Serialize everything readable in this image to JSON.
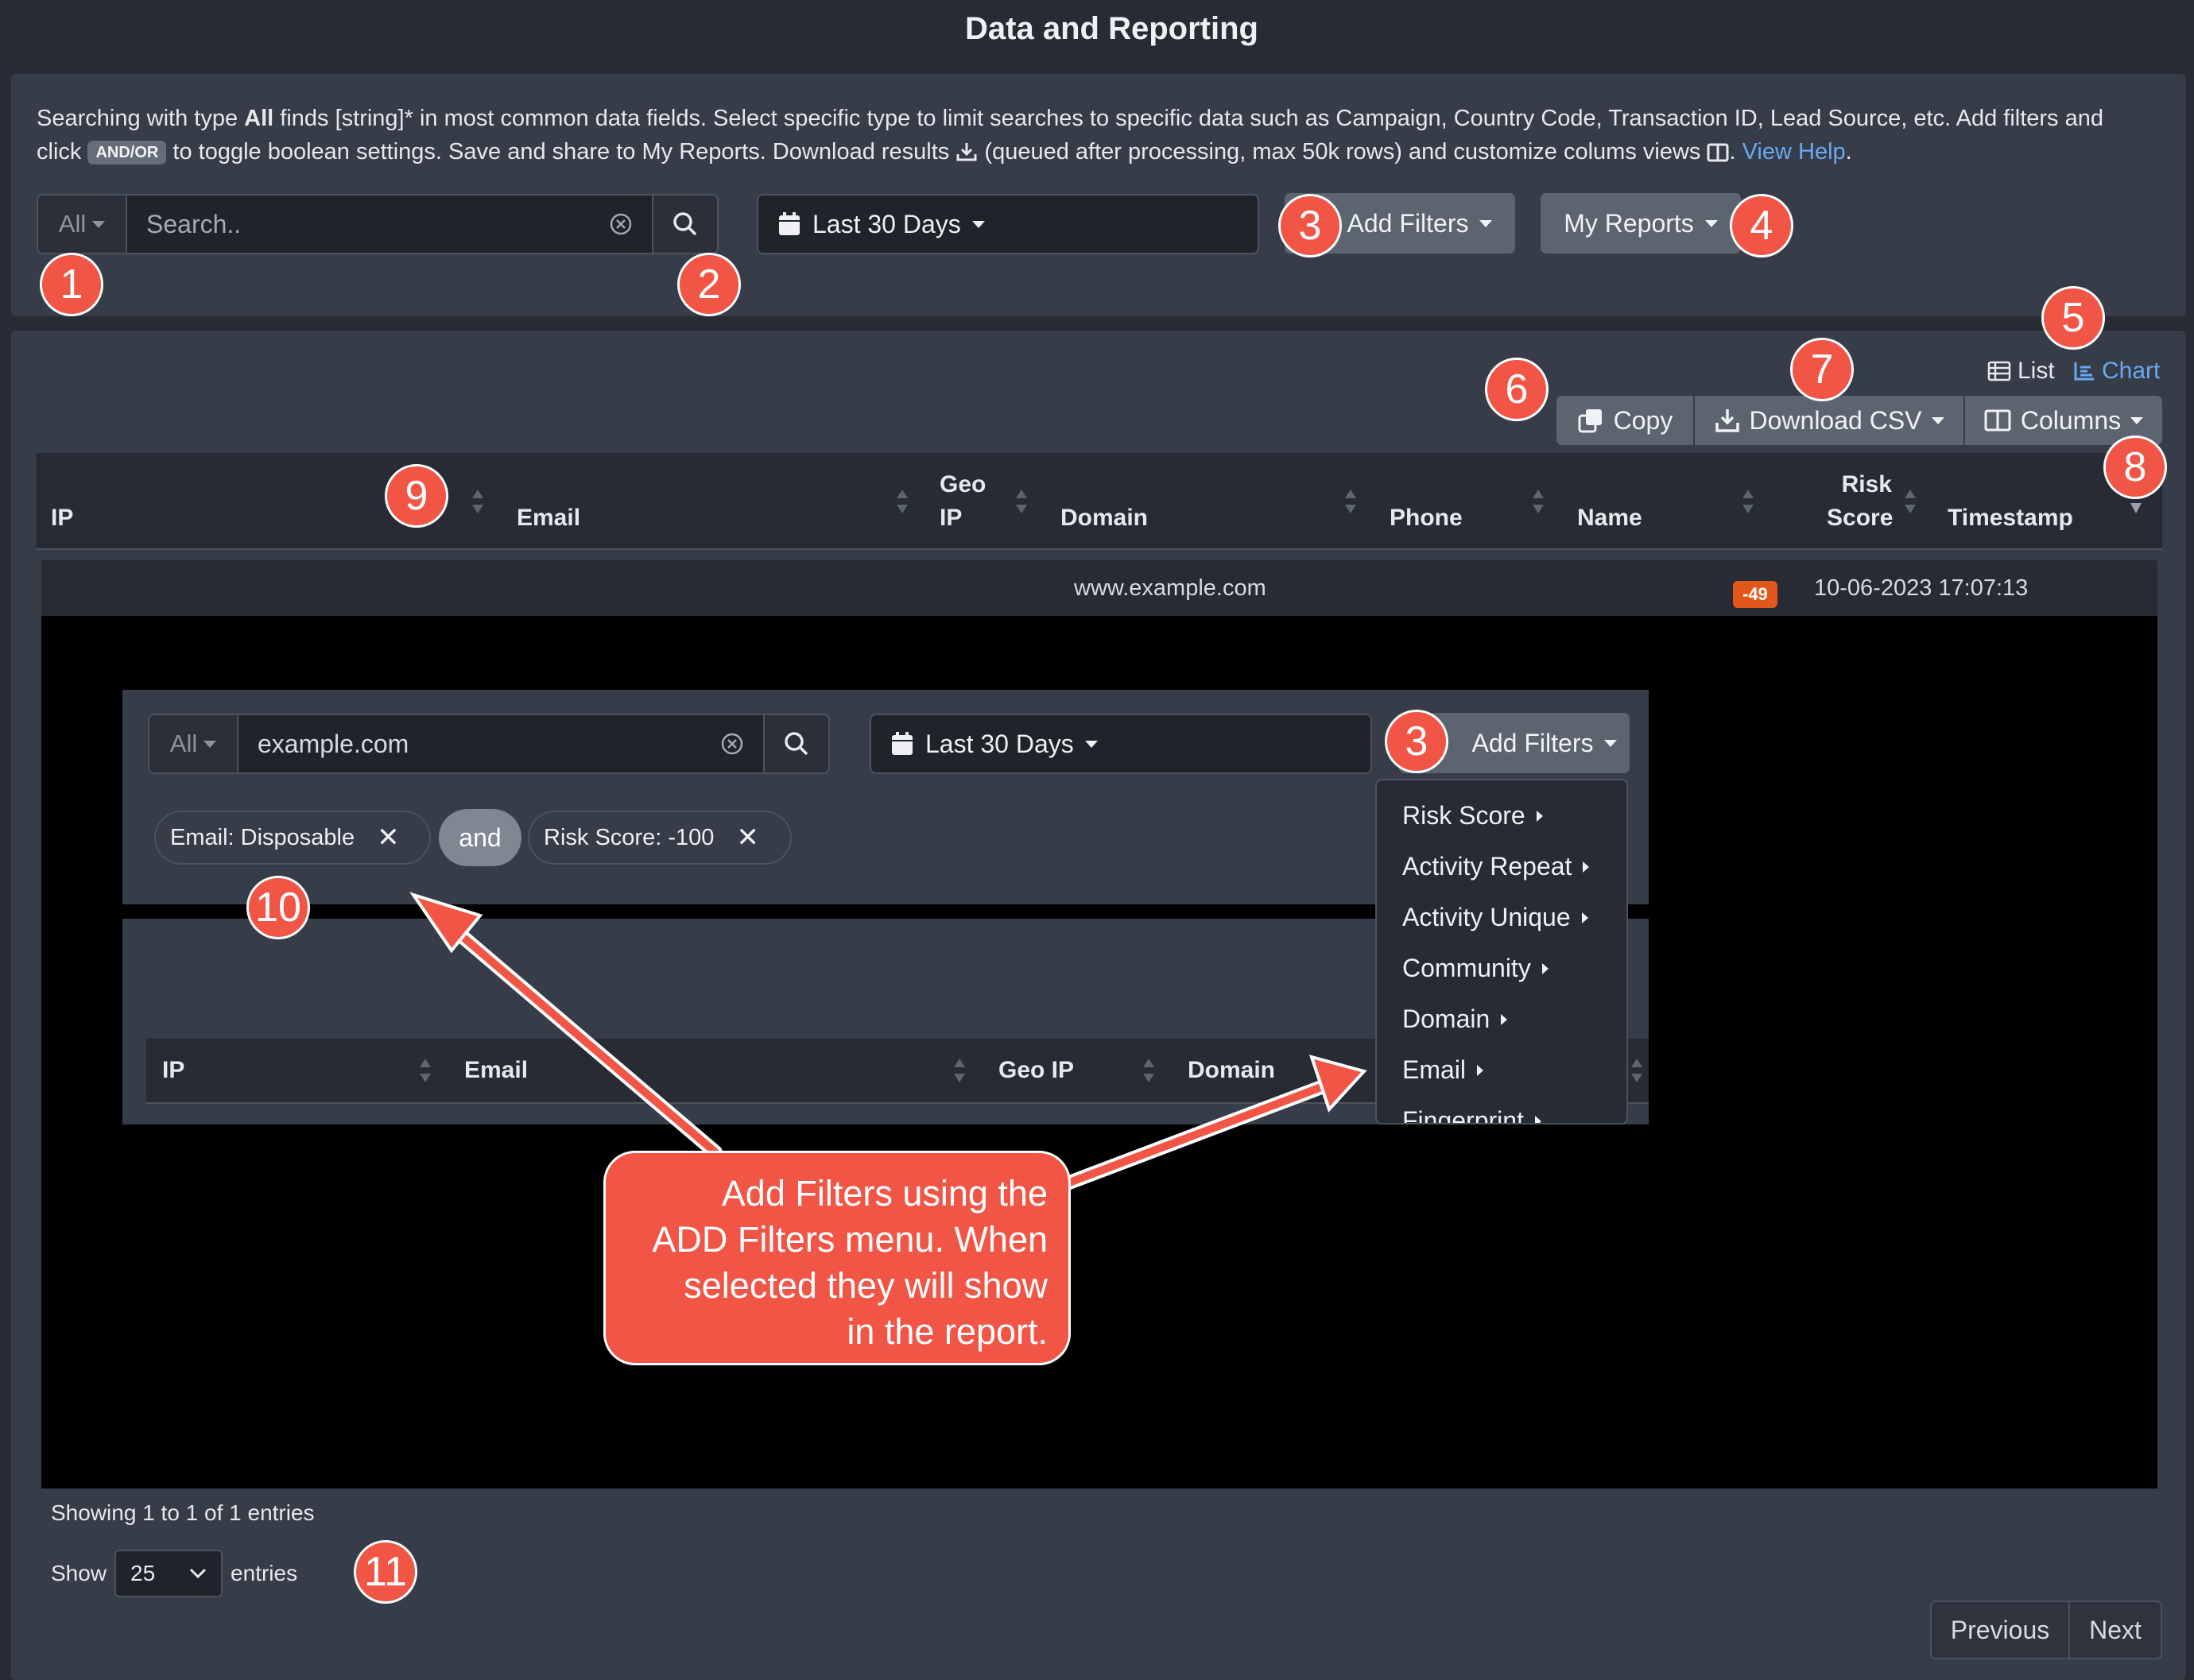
{
  "page": {
    "title": "Data and Reporting"
  },
  "help": {
    "t1": "Searching with type ",
    "t1_bold": "All",
    "t2": " finds [string]* in most common data fields. Select specific type to limit searches to specific data such as Campaign, Country Code, Transaction ID, Lead Source, etc. Add filters and click ",
    "badge": "AND/OR",
    "t3": " to toggle boolean settings. Save and share to My Reports. Download results ",
    "t4": " (queued after processing, max 50k rows) and customize colums views ",
    "t5": ". ",
    "link": "View Help",
    "t6": "."
  },
  "search": {
    "type": "All",
    "placeholder": "Search..",
    "date_range": "Last 30 Days",
    "add_filters": "Add Filters",
    "my_reports": "My Reports"
  },
  "annotations": {
    "n1": "1",
    "n2": "2",
    "n3": "3",
    "n4": "4",
    "n5": "5",
    "n6": "6",
    "n7": "7",
    "n8": "8",
    "n9": "9",
    "n10": "10",
    "n11": "11",
    "n3b": "3"
  },
  "view": {
    "list": "List",
    "chart": "Chart"
  },
  "toolbar": {
    "copy": "Copy",
    "download": "Download CSV",
    "columns": "Columns"
  },
  "table": {
    "columns": {
      "ip": "IP",
      "email": "Email",
      "geo_ip_1": "Geo",
      "geo_ip_2": "IP",
      "domain": "Domain",
      "phone": "Phone",
      "name": "Name",
      "risk_1": "Risk",
      "risk_2": "Score",
      "timestamp": "Timestamp"
    },
    "rows": [
      {
        "domain": "www.example.com",
        "risk_score": "-49",
        "timestamp": "10-06-2023 17:07:13"
      }
    ]
  },
  "inner": {
    "type": "All",
    "search_value": "example.com",
    "date_range": "Last 30 Days",
    "add_filters": "Add Filters",
    "chip1": "Email: Disposable",
    "and": "and",
    "chip2": "Risk Score: -100",
    "columns": {
      "ip": "IP",
      "email": "Email",
      "geo_ip": "Geo IP",
      "domain": "Domain"
    },
    "menu": [
      "Risk Score",
      "Activity Repeat",
      "Activity Unique",
      "Community",
      "Domain",
      "Email",
      "Fingerprint"
    ]
  },
  "callout": {
    "line1": "Add Filters using the",
    "line2": "ADD Filters menu. When",
    "line3": "selected they will show",
    "line4": "in the report."
  },
  "footer": {
    "info": "Showing 1 to 1 of 1 entries",
    "show": "Show",
    "length": "25",
    "entries": "entries",
    "previous": "Previous",
    "next": "Next"
  },
  "colors": {
    "accent_link": "#69a9f2",
    "annotation_red": "#f05546",
    "risk_badge": "#e2571a"
  }
}
